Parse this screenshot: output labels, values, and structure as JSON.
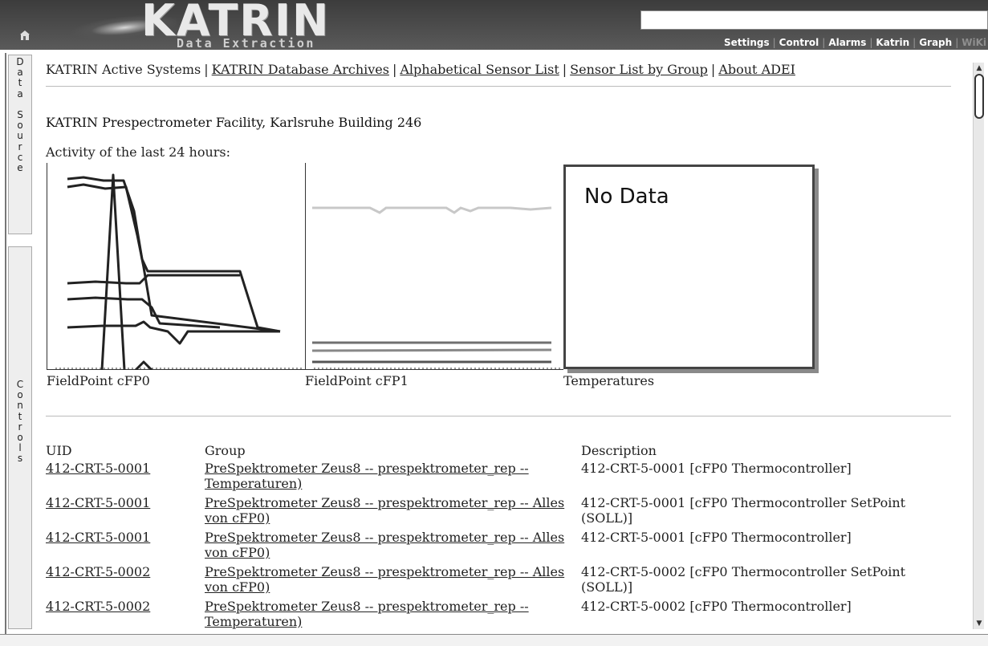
{
  "header": {
    "logo": "KATRIN",
    "subtitle": "Data Extraction",
    "menu": [
      {
        "label": "Settings",
        "dim": false
      },
      {
        "label": "Control",
        "dim": false
      },
      {
        "label": "Alarms",
        "dim": false
      },
      {
        "label": "Katrin",
        "dim": false
      },
      {
        "label": "Graph",
        "dim": false
      },
      {
        "label": "WiKi",
        "dim": true
      }
    ]
  },
  "sidebar": {
    "tabs": [
      {
        "label": "Data Source",
        "letters": [
          "D",
          "a",
          "t",
          "a",
          "",
          "S",
          "o",
          "u",
          "r",
          "c",
          "e"
        ]
      },
      {
        "label": "Controls",
        "letters": [
          "C",
          "o",
          "n",
          "t",
          "r",
          "o",
          "l",
          "s"
        ]
      }
    ]
  },
  "nav": {
    "items": [
      {
        "label": "KATRIN Active Systems",
        "link": false
      },
      {
        "label": "KATRIN Database Archives",
        "link": true
      },
      {
        "label": "Alphabetical Sensor List",
        "link": true
      },
      {
        "label": "Sensor List by Group",
        "link": true
      },
      {
        "label": "About ADEI",
        "link": true
      }
    ],
    "separator": "|"
  },
  "page": {
    "heading": "KATRIN Prespectrometer Facility, Karlsruhe Building 246",
    "activity_label": "Activity of the last 24 hours:"
  },
  "plots": [
    {
      "label": "FieldPoint cFP0"
    },
    {
      "label": "FieldPoint cFP1"
    },
    {
      "label": "Temperatures",
      "message": "No Data"
    }
  ],
  "sensor_table": {
    "headers": {
      "uid": "UID",
      "group": "Group",
      "description": "Description"
    },
    "rows": [
      {
        "uid": "412-CRT-5-0001",
        "group": "PreSpektrometer Zeus8 -- prespektrometer_rep -- Temperaturen)",
        "description": "412-CRT-5-0001 [cFP0 Thermocontroller]"
      },
      {
        "uid": "412-CRT-5-0001",
        "group": "PreSpektrometer Zeus8 -- prespektrometer_rep -- Alles von cFP0)",
        "description": "412-CRT-5-0001 [cFP0 Thermocontroller SetPoint (SOLL)]"
      },
      {
        "uid": "412-CRT-5-0001",
        "group": "PreSpektrometer Zeus8 -- prespektrometer_rep -- Alles von cFP0)",
        "description": "412-CRT-5-0001 [cFP0 Thermocontroller]"
      },
      {
        "uid": "412-CRT-5-0002",
        "group": "PreSpektrometer Zeus8 -- prespektrometer_rep -- Alles von cFP0)",
        "description": "412-CRT-5-0002 [cFP0 Thermocontroller SetPoint (SOLL)]"
      },
      {
        "uid": "412-CRT-5-0002",
        "group": "PreSpektrometer Zeus8 -- prespektrometer_rep -- Temperaturen)",
        "description": "412-CRT-5-0002 [cFP0 Thermocontroller]"
      }
    ]
  },
  "colors": {
    "header_bg": "#4a4a4a",
    "plot_line_dark": "#222222",
    "plot_line_light": "#c8c8c8",
    "plot_line_mid": "#707070"
  }
}
